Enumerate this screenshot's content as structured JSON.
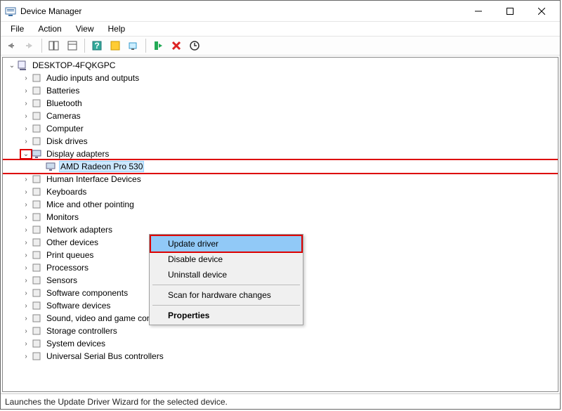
{
  "title": "Device Manager",
  "menu": {
    "file": "File",
    "action": "Action",
    "view": "View",
    "help": "Help"
  },
  "root": "DESKTOP-4FQKGPC",
  "categories": [
    "Audio inputs and outputs",
    "Batteries",
    "Bluetooth",
    "Cameras",
    "Computer",
    "Disk drives"
  ],
  "display_adapters": {
    "label": "Display adapters",
    "device": "AMD Radeon Pro 530"
  },
  "categories2": [
    "Human Interface Devices",
    "Keyboards",
    "Mice and other pointing",
    "Monitors",
    "Network adapters",
    "Other devices",
    "Print queues",
    "Processors",
    "Sensors",
    "Software components",
    "Software devices",
    "Sound, video and game controllers",
    "Storage controllers",
    "System devices",
    "Universal Serial Bus controllers"
  ],
  "context": {
    "update": "Update driver",
    "disable": "Disable device",
    "uninstall": "Uninstall device",
    "scan": "Scan for hardware changes",
    "properties": "Properties"
  },
  "status": "Launches the Update Driver Wizard for the selected device."
}
